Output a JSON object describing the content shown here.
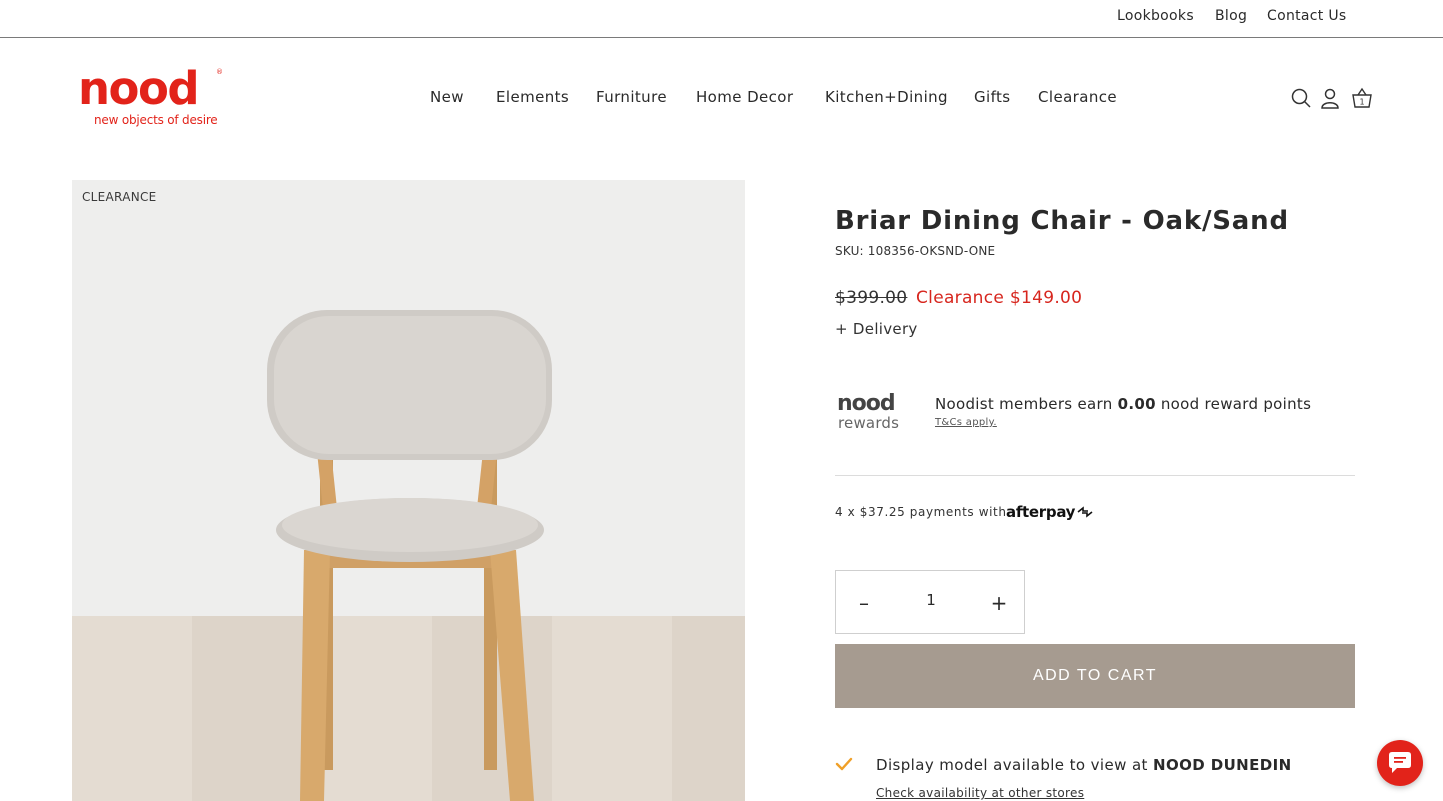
{
  "topbar": {
    "links": [
      "Lookbooks",
      "Blog",
      "Contact Us"
    ]
  },
  "brand": {
    "name": "nood",
    "tagline": "new objects of desire",
    "registered_mark": "®",
    "color": "#e2231a"
  },
  "nav": {
    "items": [
      "New",
      "Elements",
      "Furniture",
      "Home Decor",
      "Kitchen+Dining",
      "Gifts",
      "Clearance"
    ]
  },
  "header_icons": {
    "search": "search-icon",
    "account": "account-icon",
    "cart": "cart-icon",
    "cart_count": "1"
  },
  "gallery": {
    "badge": "CLEARANCE"
  },
  "product": {
    "title": "Briar Dining Chair - Oak/Sand",
    "sku": "SKU: 108356-OKSND-ONE",
    "price_original": "$399.00",
    "price_sale": "Clearance $149.00",
    "delivery": "+ Delivery",
    "sale_color": "#d7261e"
  },
  "rewards": {
    "logo_top": "nood",
    "logo_bottom": "rewards",
    "text_prefix": "Noodist members earn ",
    "points": "0.00",
    "text_suffix": " nood reward points",
    "terms": "T&Cs apply."
  },
  "afterpay": {
    "text": "4 x $37.25 payments with",
    "brand": "afterpay"
  },
  "quantity": {
    "minus": "–",
    "value": "1",
    "plus": "+"
  },
  "cart_button": {
    "label": "ADD TO CART",
    "color": "#a69b90"
  },
  "availability": {
    "text_prefix": "Display model available to view at ",
    "store": "NOOD DUNEDIN",
    "link": "Check availability at other stores"
  },
  "chat": {
    "icon": "chat-icon"
  }
}
